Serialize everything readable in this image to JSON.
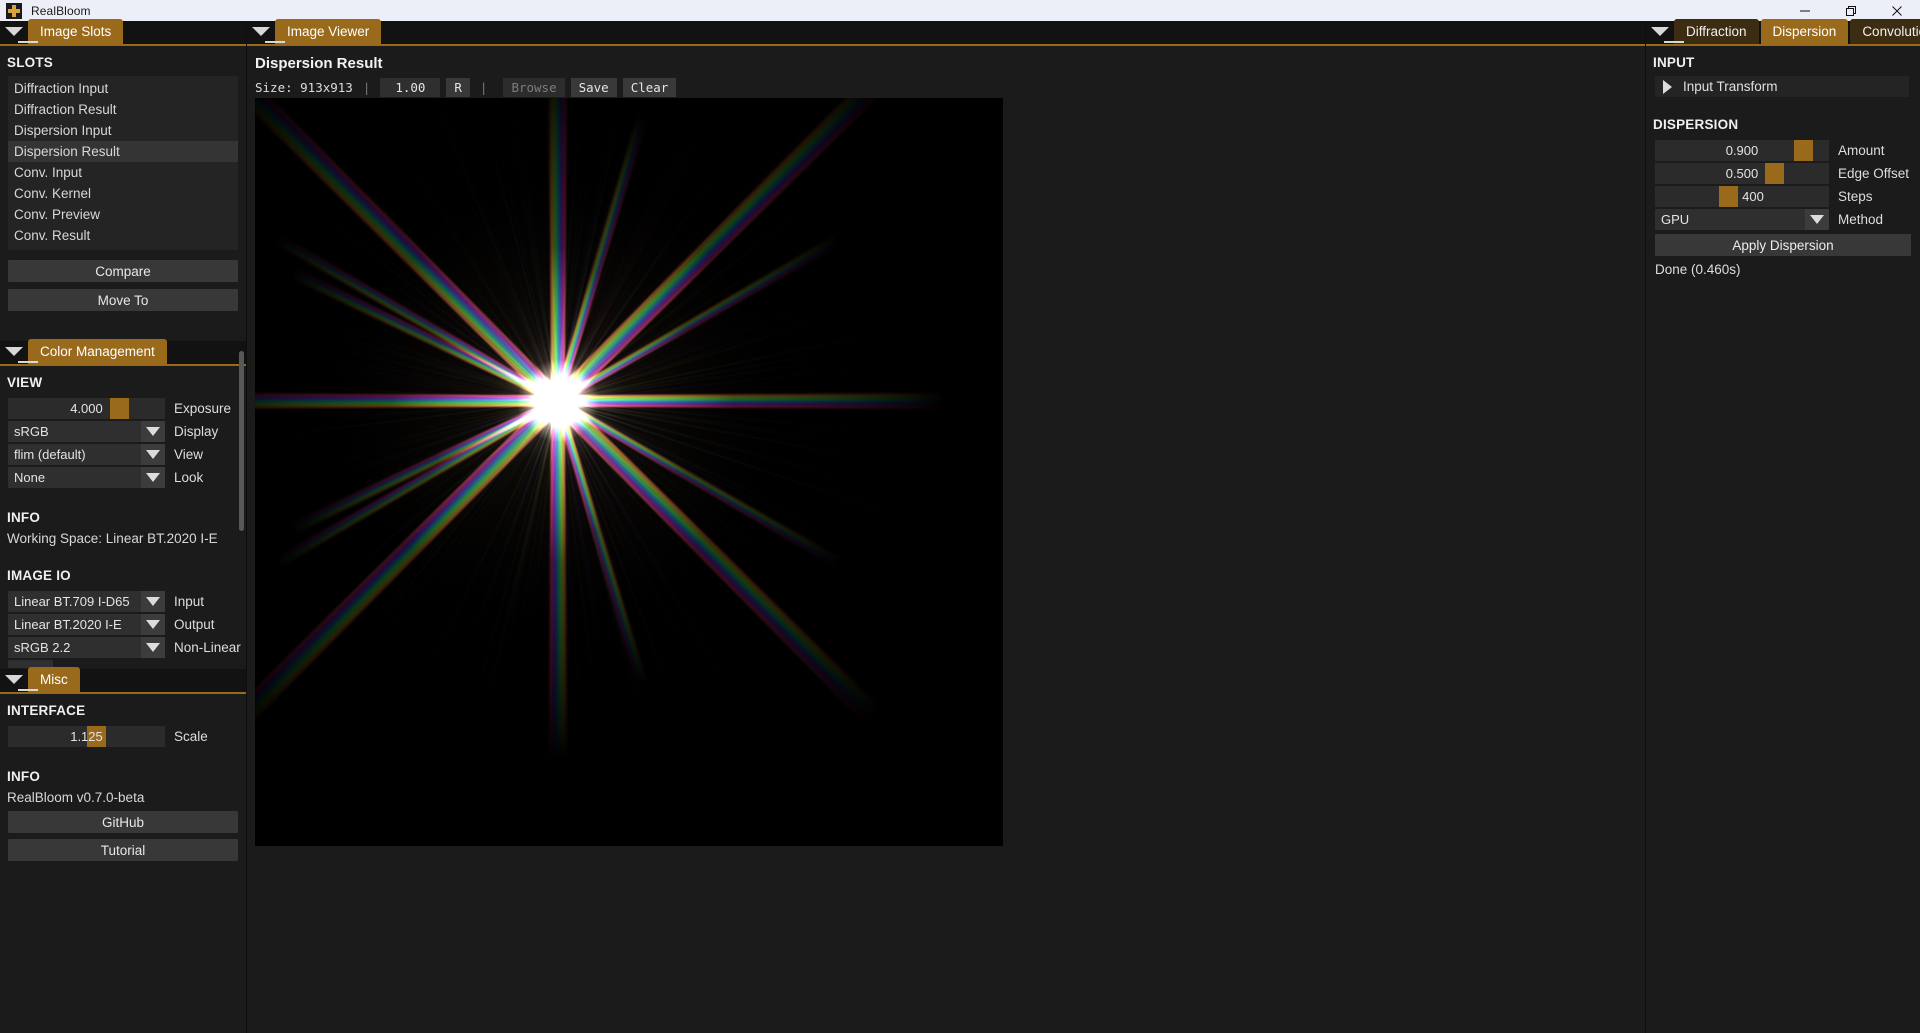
{
  "window": {
    "title": "RealBloom",
    "icon": "app-plus-icon",
    "controls": {
      "minimize": "—",
      "maximize": "❐",
      "close": "✕"
    }
  },
  "left_panel": {
    "tabbar": {
      "collapse_icon": "collapse-arrow-icon",
      "tabs": [
        {
          "label": "Image Slots",
          "active": true
        }
      ]
    },
    "slots": {
      "heading": "SLOTS",
      "items": [
        {
          "label": "Diffraction Input",
          "selected": false
        },
        {
          "label": "Diffraction Result",
          "selected": false
        },
        {
          "label": "Dispersion Input",
          "selected": false
        },
        {
          "label": "Dispersion Result",
          "selected": true
        },
        {
          "label": "Conv. Input",
          "selected": false
        },
        {
          "label": "Conv. Kernel",
          "selected": false
        },
        {
          "label": "Conv. Preview",
          "selected": false
        },
        {
          "label": "Conv. Result",
          "selected": false
        }
      ],
      "compare_label": "Compare",
      "move_to_label": "Move To"
    },
    "color_management": {
      "tabbar": {
        "collapse_icon": "collapse-arrow-icon",
        "tabs": [
          {
            "label": "Color Management",
            "active": true
          }
        ]
      },
      "view_heading": "VIEW",
      "exposure": {
        "value": "4.000",
        "label": "Exposure",
        "fill_pct": 69
      },
      "display": {
        "value": "sRGB",
        "label": "Display"
      },
      "view": {
        "value": "flim (default)",
        "label": "View"
      },
      "look": {
        "value": "None",
        "label": "Look"
      },
      "info_heading": "INFO",
      "info_text": "Working Space: Linear BT.2020 I-E",
      "image_io_heading": "IMAGE IO",
      "input": {
        "value": "Linear BT.709 I-D65",
        "label": "Input"
      },
      "output": {
        "value": "Linear BT.2020 I-E",
        "label": "Output"
      },
      "non_linear": {
        "value": "sRGB 2.2",
        "label": "Non-Linear"
      }
    },
    "misc": {
      "tabbar": {
        "collapse_icon": "collapse-arrow-icon",
        "tabs": [
          {
            "label": "Misc",
            "active": true
          }
        ]
      },
      "interface_heading": "INTERFACE",
      "scale": {
        "value": "1.125",
        "label": "Scale",
        "fill_pct": 52
      },
      "info_heading": "INFO",
      "version": "RealBloom v0.7.0-beta",
      "github_label": "GitHub",
      "tutorial_label": "Tutorial"
    }
  },
  "center_panel": {
    "tabbar": {
      "collapse_icon": "collapse-arrow-icon",
      "tabs": [
        {
          "label": "Image Viewer",
          "active": true
        }
      ]
    },
    "image_title": "Dispersion Result",
    "toolbar": {
      "size_text": "Size: 913x913",
      "separator": "|",
      "zoom_value": "1.00",
      "reset_label": "R",
      "browse_label": "Browse",
      "browse_enabled": false,
      "save_label": "Save",
      "clear_label": "Clear"
    }
  },
  "right_panel": {
    "tabbar": {
      "collapse_icon": "collapse-arrow-icon",
      "tabs": [
        {
          "label": "Diffraction",
          "active": false
        },
        {
          "label": "Dispersion",
          "active": true
        },
        {
          "label": "Convolution",
          "active": false
        }
      ]
    },
    "input_heading": "INPUT",
    "input_transform": {
      "label": "Input Transform",
      "expand_icon": "triangle-right-icon",
      "expanded": false
    },
    "dispersion_heading": "DISPERSION",
    "amount": {
      "value": "0.900",
      "label": "Amount",
      "fill_pct": 88
    },
    "edge_offset": {
      "value": "0.500",
      "label": "Edge Offset",
      "fill_pct": 50
    },
    "steps": {
      "value": "400",
      "label": "Steps",
      "fill_pct": 26
    },
    "method": {
      "value": "GPU",
      "label": "Method"
    },
    "apply_label": "Apply Dispersion",
    "status": "Done (0.460s)"
  },
  "colors": {
    "accent": "#9a6a1c",
    "accent_dim": "#3c2c12",
    "bg": "#1b1b1b",
    "panel_bg": "#242424",
    "field_bg": "#2b2b2b",
    "button_bg": "#383838",
    "titlebar_bg": "#eceff8",
    "text": "#e4e4e4"
  }
}
